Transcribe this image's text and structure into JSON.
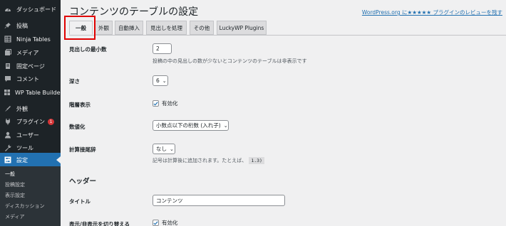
{
  "sidebar": {
    "items": [
      {
        "label": "ダッシュボード",
        "icon": "dashboard-icon"
      },
      {
        "label": "投稿",
        "icon": "pin-icon"
      },
      {
        "label": "Ninja Tables",
        "icon": "table-icon"
      },
      {
        "label": "メディア",
        "icon": "media-icon"
      },
      {
        "label": "固定ページ",
        "icon": "page-icon"
      },
      {
        "label": "コメント",
        "icon": "comment-icon"
      },
      {
        "label": "WP Table Builder",
        "icon": "table-builder-icon"
      },
      {
        "label": "外観",
        "icon": "appearance-icon"
      },
      {
        "label": "プラグイン",
        "icon": "plugin-icon",
        "badge": "1"
      },
      {
        "label": "ユーザー",
        "icon": "user-icon"
      },
      {
        "label": "ツール",
        "icon": "tools-icon"
      },
      {
        "label": "設定",
        "icon": "settings-icon",
        "active": true
      }
    ],
    "submenu": [
      "一般",
      "投稿設定",
      "表示設定",
      "ディスカッション",
      "メディア"
    ]
  },
  "header": {
    "title": "コンテンツのテーブルの設定",
    "review_link": "WordPress.org に★★★★★ プラグインのレビューを残す"
  },
  "tabs": [
    {
      "label": "一般",
      "active": true
    },
    {
      "label": "外観"
    },
    {
      "label": "自動挿入"
    },
    {
      "label": "見出しを処理"
    },
    {
      "label": "その他"
    },
    {
      "label": "LuckyWP Plugins"
    }
  ],
  "settings": {
    "min_headings": {
      "label": "見出しの最小数",
      "value": "2",
      "description": "投稿の中の見出しの数が少ないとコンテンツのテーブルは非表示です"
    },
    "depth": {
      "label": "深さ",
      "value": "6"
    },
    "hierarchical": {
      "label": "階層表示",
      "checkbox_label": "有効化",
      "checked": true
    },
    "numeration": {
      "label": "数値化",
      "value": "小数点以下の桁数 (入れ子)"
    },
    "numeration_suffix": {
      "label": "計算接尾辞",
      "value": "なし",
      "description": "記号は計算後に追加されます。たとえば、",
      "example": "1.3)"
    },
    "header_section": {
      "heading": "ヘッダー"
    },
    "title": {
      "label": "タイトル",
      "value": "コンテンツ"
    },
    "toggle": {
      "label": "表示/非表示を切り替える",
      "checkbox_label": "有効化",
      "checked": true
    }
  },
  "colors": {
    "sidebar_bg": "#1d2327",
    "active_menu": "#2271b1",
    "link": "#2271b1",
    "highlight_border": "#e00000",
    "badge": "#d63638"
  }
}
